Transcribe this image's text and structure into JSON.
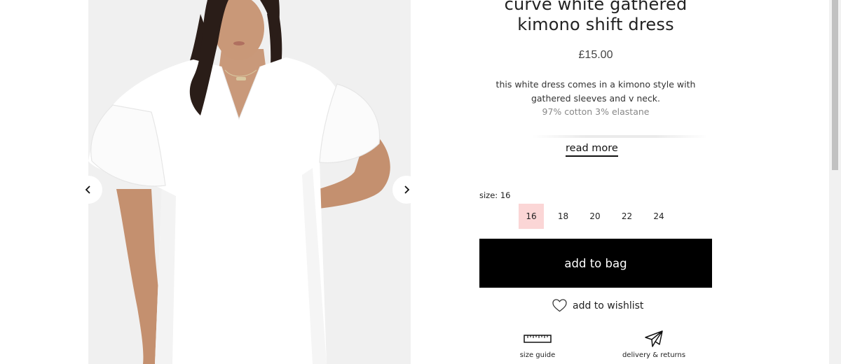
{
  "product": {
    "title_line1": "curve white gathered",
    "title_line2": "kimono shift dress",
    "price": "£15.00",
    "description_line1": "this white dress comes in a kimono style with",
    "description_line2": "gathered sleeves and v neck.",
    "material": "97% cotton 3% elastane",
    "read_more": "read more"
  },
  "gallery": {
    "prev_icon": "chevron-left-icon",
    "next_icon": "chevron-right-icon"
  },
  "sizes": {
    "label": "size: 16",
    "options": [
      "16",
      "18",
      "20",
      "22",
      "24"
    ],
    "selected": "16",
    "selected_color": "#fbd6d6"
  },
  "actions": {
    "add_to_bag": "add to bag",
    "add_to_wishlist": "add to wishlist",
    "wishlist_icon": "heart-outline-icon"
  },
  "utilities": {
    "size_guide": "size guide",
    "size_guide_icon": "ruler-icon",
    "delivery": "delivery & returns",
    "delivery_icon": "paper-plane-icon"
  },
  "colors": {
    "button_bg": "#000000",
    "button_text": "#ffffff",
    "gallery_bg": "#f1f1f1"
  }
}
